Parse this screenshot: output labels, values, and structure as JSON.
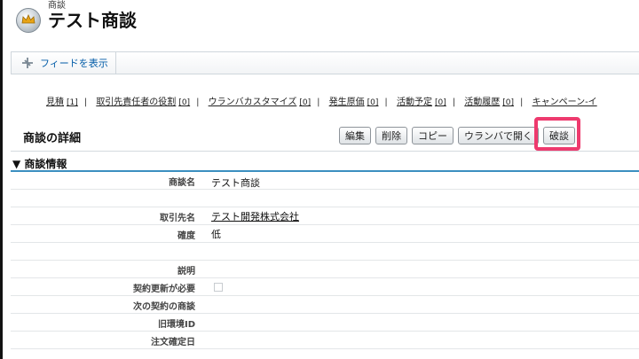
{
  "header": {
    "subtitle": "商談",
    "title": "テスト商談"
  },
  "feed": {
    "label": "フィードを表示"
  },
  "related_links": [
    {
      "label": "見積",
      "count": "[1]"
    },
    {
      "label": "取引先責任者の役割",
      "count": "[0]"
    },
    {
      "label": "ウランバカスタマイズ",
      "count": "[0]"
    },
    {
      "label": "発生原価",
      "count": "[0]"
    },
    {
      "label": "活動予定",
      "count": "[0]"
    },
    {
      "label": "活動履歴",
      "count": "[0]"
    },
    {
      "label": "キャンペーン-イ",
      "count": ""
    }
  ],
  "detail": {
    "title": "商談の詳細",
    "buttons": {
      "edit": "編集",
      "delete": "削除",
      "copy": "コピー",
      "open_ulanba": "ウランバで開く",
      "hadan": "破談"
    }
  },
  "section": {
    "title": "▼ 商談情報"
  },
  "fields": {
    "name": {
      "label": "商談名",
      "value": "テスト商談"
    },
    "account": {
      "label": "取引先名",
      "value": "テスト開発株式会社"
    },
    "probability": {
      "label": "確度",
      "value": "低"
    },
    "description": {
      "label": "説明",
      "value": ""
    },
    "renewal": {
      "label": "契約更新が必要",
      "value": ""
    },
    "next_deal": {
      "label": "次の契約の商談",
      "value": ""
    },
    "legacy_id": {
      "label": "旧環境ID",
      "value": ""
    },
    "order_date": {
      "label": "注文確定日",
      "value": ""
    }
  },
  "colors": {
    "highlight": "#ee3a6e",
    "link": "#015ba7",
    "section_line": "#3b8fc0"
  }
}
